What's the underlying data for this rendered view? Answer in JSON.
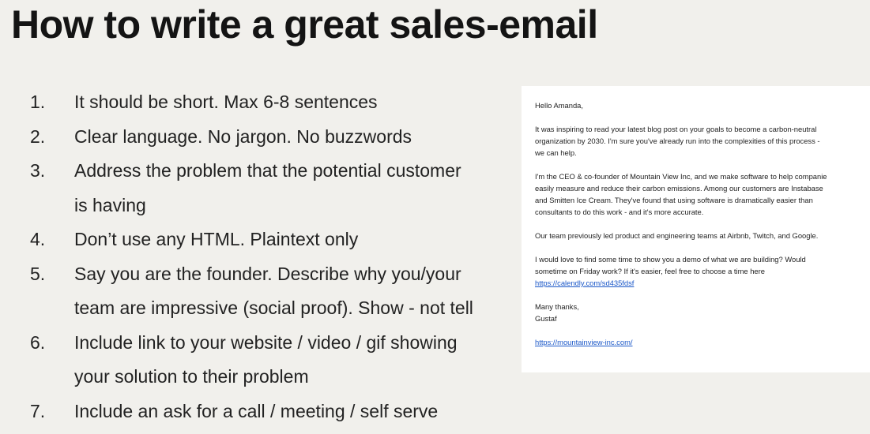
{
  "slide": {
    "title": "How to write a great sales-email",
    "items": [
      {
        "number": "1.",
        "text": "It should be short. Max 6-8 sentences"
      },
      {
        "number": "2.",
        "text": "Clear language. No jargon. No buzzwords"
      },
      {
        "number": "3.",
        "text": "Address the problem that the potential customer\nis having"
      },
      {
        "number": "4.",
        "text": "Don’t use any HTML. Plaintext only"
      },
      {
        "number": "5.",
        "text": "Say you are the founder. Describe why you/your\nteam are impressive (social proof). Show - not tell"
      },
      {
        "number": "6.",
        "text": "Include link to your website / video / gif showing\nyour solution to their problem"
      },
      {
        "number": "7.",
        "text": "Include an ask for a call / meeting / self serve"
      }
    ]
  },
  "email": {
    "greeting": "Hello Amanda,",
    "para1": "It was inspiring to read your latest blog post on your goals to become a carbon-neutral\norganization by 2030. I'm sure you've already run into the complexities of this process -\nwe can help.",
    "para2": "I'm the CEO & co-founder of Mountain View Inc, and we make software to help companie\neasily measure and reduce their carbon emissions. Among our customers are Instabase\nand Smitten Ice Cream. They've found that using software is dramatically easier than\nconsultants to do this work - and it's more accurate.",
    "para3": "Our team previously led product and engineering teams at Airbnb, Twitch, and Google.",
    "para4": "I would love to find some time to show you a demo of what we are building? Would\nsometime on Friday work? If it's easier, feel free to choose a time here",
    "calendly_link": "https://calendly.com/sd435fdsf",
    "signoff": "Many thanks,",
    "signature": "Gustaf",
    "website_link": "https://mountainview-inc.com/"
  }
}
